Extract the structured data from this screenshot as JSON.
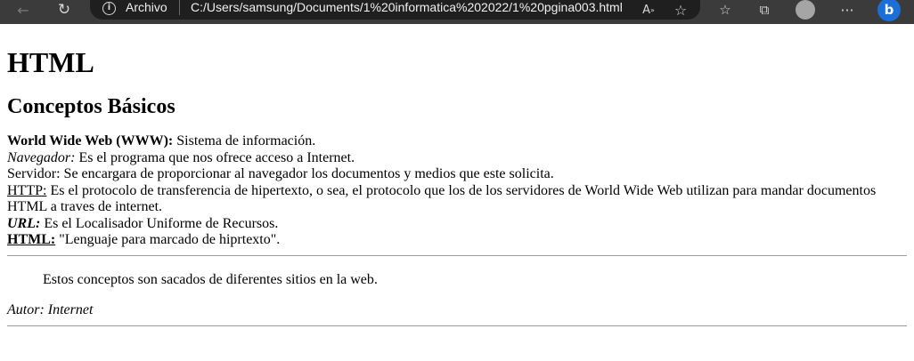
{
  "browser": {
    "address_scheme": "Archivo",
    "address_url": "C:/Users/samsung/Documents/1%20informatica%202022/1%20pgina003.html",
    "toolbar_bg": "#3b3b3b",
    "icons": [
      "back-arrow-icon",
      "refresh-icon",
      "info-icon",
      "read-aloud-icon",
      "favorite-star-icon",
      "favorites-list-icon",
      "collections-icon",
      "profile-avatar-icon",
      "more-options-icon",
      "bing-icon"
    ]
  },
  "page": {
    "h1": "HTML",
    "h2": "Conceptos Básicos",
    "definitions": [
      {
        "term": "World Wide Web (WWW):",
        "style": "bold",
        "text": " Sistema de información."
      },
      {
        "term": "Navegador:",
        "style": "italic",
        "text": " Es el programa que nos ofrece acceso a Internet."
      },
      {
        "term": "",
        "style": "plain",
        "text": "Servidor: Se encargara de proporcionar al navegador los documentos y medios que este solicita."
      },
      {
        "term": "HTTP:",
        "style": "underline",
        "text": " Es el protocolo de transferencia de hipertexto, o sea, el protocolo que los de los servidores de World Wide Web utilizan para mandar documentos HTML a traves de internet."
      },
      {
        "term": "URL:",
        "style": "bold-italic",
        "text": " Es el Localisador Uniforme de Recursos."
      },
      {
        "term": "HTML:",
        "style": "bold-underline",
        "text": " \"Lenguaje para marcado de hiprtexto\"."
      }
    ],
    "quote": "Estos conceptos son sacados de diferentes sitios en la web.",
    "author": "Autor: Internet"
  }
}
